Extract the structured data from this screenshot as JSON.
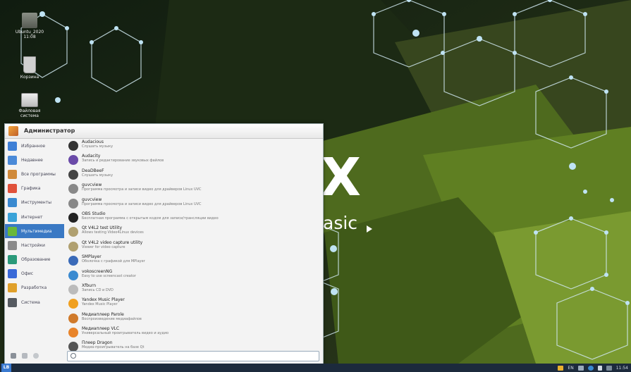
{
  "desktop": {
    "brand_letter": "X",
    "brand_suffix": "asic",
    "icons": [
      {
        "label": "Ubuntu_2020\n11:08"
      },
      {
        "label": "Корзина"
      },
      {
        "label": "Файловая\nсистема"
      }
    ]
  },
  "menu": {
    "user_name": "Администратор",
    "categories": [
      {
        "label": "Избранное",
        "color": "#3d7fd6",
        "active": false
      },
      {
        "label": "Недавнее",
        "color": "#4a8ad8",
        "active": false
      },
      {
        "label": "Все программы",
        "color": "#d08a3a",
        "active": false
      },
      {
        "label": "Графика",
        "color": "#e0513a",
        "active": false
      },
      {
        "label": "Инструменты",
        "color": "#3a8ad0",
        "active": false
      },
      {
        "label": "Интернет",
        "color": "#3aa3d8",
        "active": false
      },
      {
        "label": "Мультимедиа",
        "color": "#6ab83a",
        "active": true
      },
      {
        "label": "Настройки",
        "color": "#8a8a8a",
        "active": false
      },
      {
        "label": "Образование",
        "color": "#2a9a7a",
        "active": false
      },
      {
        "label": "Офис",
        "color": "#3a6ad8",
        "active": false
      },
      {
        "label": "Разработка",
        "color": "#e0a02a",
        "active": false
      },
      {
        "label": "Система",
        "color": "#555a60",
        "active": false
      }
    ],
    "apps": [
      {
        "name": "Audacious",
        "desc": "Слушать музыку",
        "color": "#333"
      },
      {
        "name": "Audacity",
        "desc": "Запись и редактирование звуковых файлов",
        "color": "#6a4aa8"
      },
      {
        "name": "DeaDBeeF",
        "desc": "Слушать музыку",
        "color": "#444"
      },
      {
        "name": "guvcview",
        "desc": "Программа просмотра и записи видео для драйверов Linux UVC",
        "color": "#888"
      },
      {
        "name": "guvcview",
        "desc": "Программа просмотра и записи видео для драйверов Linux UVC",
        "color": "#888"
      },
      {
        "name": "OBS Studio",
        "desc": "Бесплатная программа с открытым кодом для записи/трансляции видео",
        "color": "#222"
      },
      {
        "name": "Qt V4L2 test Utility",
        "desc": "Allows testing Video4Linux devices",
        "color": "#b0a070"
      },
      {
        "name": "Qt V4L2 video capture utility",
        "desc": "Viewer for video capture",
        "color": "#b0a070"
      },
      {
        "name": "SMPlayer",
        "desc": "Оболочка с графикой для MPlayer",
        "color": "#3a6ab8"
      },
      {
        "name": "vokoscreenNG",
        "desc": "Easy to use screencast creator",
        "color": "#3a8ad0"
      },
      {
        "name": "Xfburn",
        "desc": "Запись CD и DVD",
        "color": "#bbb"
      },
      {
        "name": "Yandex Music Player",
        "desc": "Yandex Music Player",
        "color": "#f0a020"
      },
      {
        "name": "Медиаплеер Parole",
        "desc": "Воспроизведение медиафайлов",
        "color": "#d07a2a"
      },
      {
        "name": "Медиаплеер VLC",
        "desc": "Универсальный проигрыватель видео и аудио",
        "color": "#e8842a"
      },
      {
        "name": "Плеер Dragon",
        "desc": "Медиа-проигрыватель на базе Qt",
        "color": "#555"
      }
    ],
    "search": {
      "placeholder": "",
      "value": ""
    }
  },
  "taskbar": {
    "start_label": "LB",
    "lang": "EN",
    "time": "11:54"
  }
}
